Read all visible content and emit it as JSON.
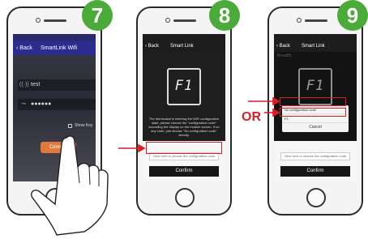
{
  "steps": {
    "s7": {
      "number": "7",
      "nav": {
        "back": "Back",
        "title": "SmartLink Wifi"
      },
      "ssid": "test",
      "password": "●●●●●●",
      "show_key": "Show Key",
      "connect": "Connect"
    },
    "s8": {
      "number": "8",
      "nav": {
        "back": "Back",
        "title": "Smart Link"
      },
      "display_code": "F1",
      "description": "The thermostat is entering the WiFi configuration state, please choose the \"configuration code\" according the display on the module screen. If no any code, just choose \"No configuration code\" directly.",
      "choose": "Click here to choose the configuration code",
      "confirm": "Confirm"
    },
    "s9": {
      "number": "9",
      "nav": {
        "back": "Back",
        "title": "Smart Link"
      },
      "breadth": "Breadth",
      "display_code": "F1",
      "options": [
        "No configuration code",
        "F1"
      ],
      "cancel": "Cancel",
      "choose": "Click here to choose the configuration code",
      "confirm": "Confirm"
    }
  },
  "or_label": "OR",
  "colors": {
    "badge": "#4aaa3a",
    "highlight": "#d71f26",
    "nav7": "#2b2c8e",
    "connect": "#e07a3c"
  }
}
